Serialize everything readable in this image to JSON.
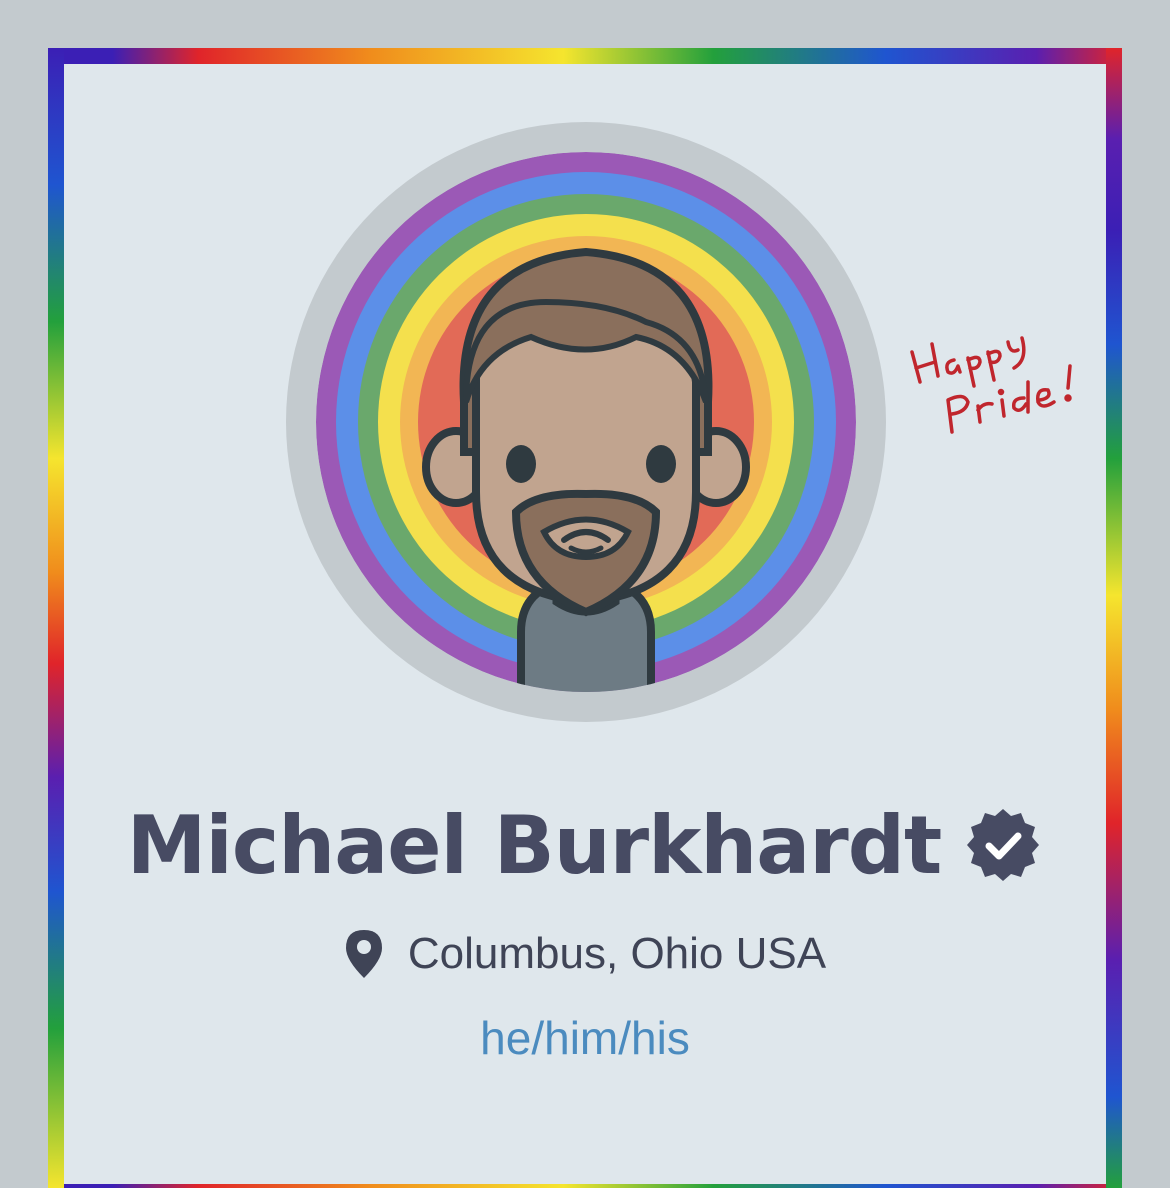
{
  "profile": {
    "name": "Michael Burkhardt",
    "location": "Columbus, Ohio USA",
    "pronouns": "he/him/his",
    "pride_note": "Happy Pride!",
    "verified_icon": "verified-badge-icon",
    "location_icon": "map-pin-icon"
  },
  "colors": {
    "background": "#c3cace",
    "card": "#dfe7ec",
    "name": "#474b63",
    "pronouns_link": "#4b8bbf",
    "note_ink": "#c0262d",
    "rainbow": [
      "#9b59b6",
      "#5c8fe8",
      "#6aa86c",
      "#f4e04d",
      "#f2b654",
      "#e26a57"
    ]
  }
}
